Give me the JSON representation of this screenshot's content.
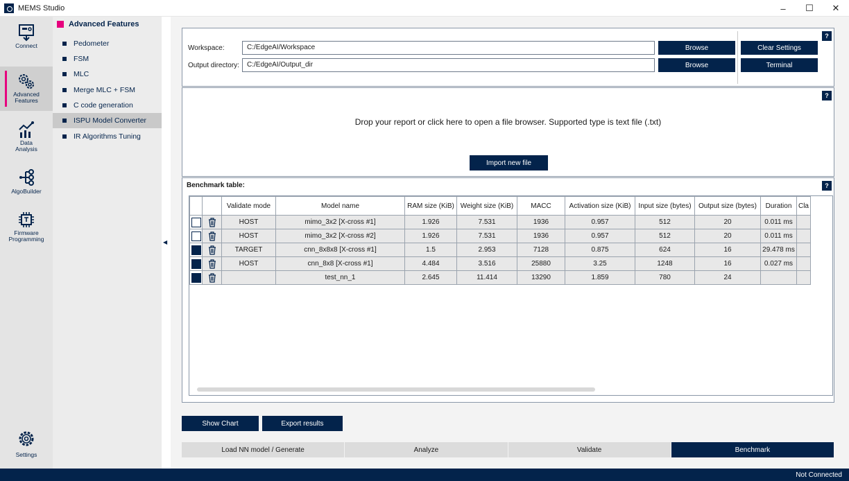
{
  "window": {
    "title": "MEMS Studio",
    "minimize": "–",
    "maximize": "☐",
    "close": "✕"
  },
  "rail": {
    "items": [
      {
        "label": "Connect"
      },
      {
        "label": "Advanced Features"
      },
      {
        "label": "Data Analysis"
      },
      {
        "label": "AlgoBuilder"
      },
      {
        "label": "Firmware Programming"
      }
    ],
    "settings_label": "Settings"
  },
  "submenu": {
    "title": "Advanced Features",
    "items": [
      {
        "label": "Pedometer"
      },
      {
        "label": "FSM"
      },
      {
        "label": "MLC"
      },
      {
        "label": "Merge MLC + FSM"
      },
      {
        "label": "C code generation"
      },
      {
        "label": "ISPU Model Converter"
      },
      {
        "label": "IR Algorithms Tuning"
      }
    ],
    "collapse_glyph": "◀"
  },
  "workspace": {
    "help": "?",
    "workspace_label": "Workspace:",
    "workspace_value": "C:/EdgeAI/Workspace",
    "output_label": "Output directory:",
    "output_value": "C:/EdgeAI/Output_dir",
    "browse_label": "Browse",
    "clear_settings_label": "Clear Settings",
    "terminal_label": "Terminal"
  },
  "dropzone": {
    "help": "?",
    "text": "Drop your report or click here to open a file browser. Supported type is text file (.txt)",
    "import_label": "Import new file"
  },
  "benchmark": {
    "help": "?",
    "title": "Benchmark table:",
    "columns": [
      "",
      "",
      "Validate mode",
      "Model name",
      "RAM size (KiB)",
      "Weight size (KiB)",
      "MACC",
      "Activation size (KiB)",
      "Input size (bytes)",
      "Output size (bytes)",
      "Duration",
      "Cla"
    ],
    "rows": [
      {
        "checked": false,
        "mode": "HOST",
        "model": "mimo_3x2 [X-cross #1]",
        "ram": "1.926",
        "weight": "7.531",
        "macc": "1936",
        "activation": "0.957",
        "input": "512",
        "output": "20",
        "duration": "0.011 ms"
      },
      {
        "checked": false,
        "mode": "HOST",
        "model": "mimo_3x2 [X-cross #2]",
        "ram": "1.926",
        "weight": "7.531",
        "macc": "1936",
        "activation": "0.957",
        "input": "512",
        "output": "20",
        "duration": "0.011 ms"
      },
      {
        "checked": true,
        "mode": "TARGET",
        "model": "cnn_8x8x8 [X-cross #1]",
        "ram": "1.5",
        "weight": "2.953",
        "macc": "7128",
        "activation": "0.875",
        "input": "624",
        "output": "16",
        "duration": "29.478 ms"
      },
      {
        "checked": true,
        "mode": "HOST",
        "model": "cnn_8x8 [X-cross #1]",
        "ram": "4.484",
        "weight": "3.516",
        "macc": "25880",
        "activation": "3.25",
        "input": "1248",
        "output": "16",
        "duration": "0.027 ms"
      },
      {
        "checked": true,
        "mode": "",
        "model": "test_nn_1",
        "ram": "2.645",
        "weight": "11.414",
        "macc": "13290",
        "activation": "1.859",
        "input": "780",
        "output": "24",
        "duration": ""
      }
    ]
  },
  "actions": {
    "show_chart_label": "Show Chart",
    "export_label": "Export results"
  },
  "tabs": [
    {
      "label": "Load NN model / Generate"
    },
    {
      "label": "Analyze"
    },
    {
      "label": "Validate"
    },
    {
      "label": "Benchmark"
    }
  ],
  "status": {
    "connection": "Not Connected"
  },
  "colors": {
    "brand_navy": "#03234b",
    "accent_pink": "#e6007e"
  }
}
